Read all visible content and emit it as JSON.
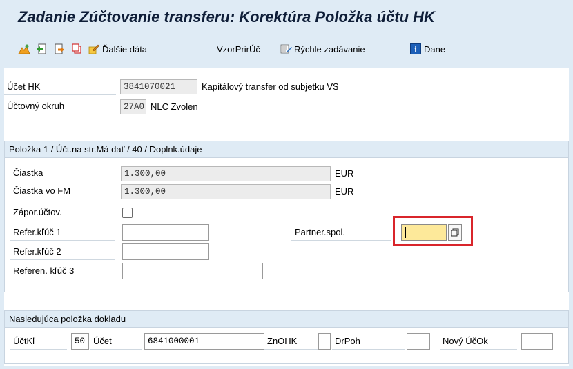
{
  "title": "Zadanie Zúčtovanie transferu: Korektúra Položka účtu HK",
  "toolbar": {
    "dalsie_data": "Ďalšie dáta",
    "vzor": "VzorPrirÚč",
    "rychle": "Rýchle zadávanie",
    "dane": "Dane"
  },
  "header_fields": {
    "ucet_hk_label": "Účet HK",
    "ucet_hk_value": "3841070021",
    "ucet_hk_text": "Kapitálový transfer od subjetku VS",
    "okruh_label": "Účtovný okruh",
    "okruh_value": "27A0",
    "okruh_text": "NLC Zvolen"
  },
  "item_group": {
    "title": "Položka 1 / Účt.na str.Má dať / 40 / Doplnk.údaje",
    "ciastka_label": "Čiastka",
    "ciastka_value": "1.300,00",
    "ciastka_currency": "EUR",
    "ciastka_fm_label": "Čiastka vo FM",
    "ciastka_fm_value": "1.300,00",
    "ciastka_fm_currency": "EUR",
    "zapor_label": "Zápor.účtov.",
    "ref1_label": "Refer.kľúč 1",
    "ref2_label": "Refer.kľúč 2",
    "ref3_label": "Referen. kľúč 3",
    "partner_label": "Partner.spol."
  },
  "next_group": {
    "title": "Nasledujúca položka dokladu",
    "uctkl_label": "ÚčtKľ",
    "uctkl_value": "50",
    "ucet_label": "Účet",
    "ucet_value": "6841000001",
    "znohk_label": "ZnOHK",
    "drpoh_label": "DrPoh",
    "novy_label": "Nový ÚčOk"
  },
  "colors": {
    "accent_border": "#d9252b",
    "focused_input": "#fde99a",
    "background": "#dfebf5"
  }
}
